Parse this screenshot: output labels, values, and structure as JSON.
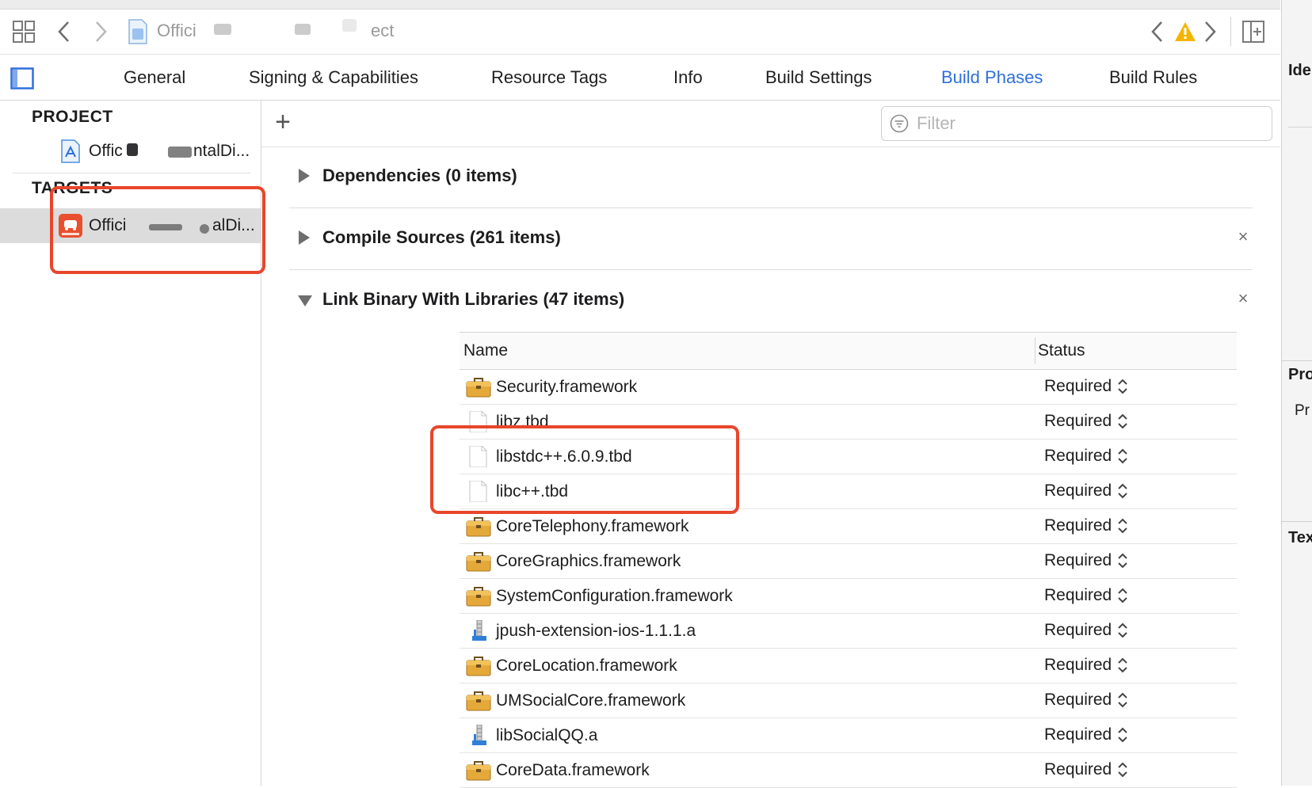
{
  "toolbar": {
    "breadcrumb_project": "Offici",
    "breadcrumb_tail": "ect",
    "icons": [
      "grid-icon",
      "back-icon",
      "forward-icon",
      "project-file-icon",
      "nav-prev-icon",
      "warning-icon",
      "nav-next-icon",
      "add-editor-icon"
    ],
    "warning_color": "#f5b400"
  },
  "tabs": [
    {
      "label": "General"
    },
    {
      "label": "Signing & Capabilities"
    },
    {
      "label": "Resource Tags"
    },
    {
      "label": "Info"
    },
    {
      "label": "Build Settings"
    },
    {
      "label": "Build Phases",
      "active": true
    },
    {
      "label": "Build Rules"
    }
  ],
  "sidebar": {
    "project_header": "PROJECT",
    "project_item": {
      "prefix": "Offic",
      "suffix": "ntalDi..."
    },
    "targets_header": "TARGETS",
    "target_item": {
      "prefix": "Offici",
      "suffix": "alDi..."
    }
  },
  "main": {
    "add_label": "+",
    "filter_placeholder": "Filter",
    "phases": [
      {
        "title": "Dependencies (0 items)",
        "expanded": false,
        "removable": false
      },
      {
        "title": "Compile Sources (261 items)",
        "expanded": false,
        "removable": true
      },
      {
        "title": "Link Binary With Libraries (47 items)",
        "expanded": true,
        "removable": true
      }
    ],
    "close_glyph": "×",
    "table": {
      "col_name": "Name",
      "col_status": "Status",
      "rows": [
        {
          "name": "Security.framework",
          "status": "Required",
          "icon": "framework-toolbox-icon"
        },
        {
          "name": "libz.tbd",
          "status": "Required",
          "icon": "tbd-file-icon"
        },
        {
          "name": "libstdc++.6.0.9.tbd",
          "status": "Required",
          "icon": "tbd-file-icon"
        },
        {
          "name": "libc++.tbd",
          "status": "Required",
          "icon": "tbd-file-icon"
        },
        {
          "name": "CoreTelephony.framework",
          "status": "Required",
          "icon": "framework-toolbox-icon"
        },
        {
          "name": "CoreGraphics.framework",
          "status": "Required",
          "icon": "framework-toolbox-icon"
        },
        {
          "name": "SystemConfiguration.framework",
          "status": "Required",
          "icon": "framework-toolbox-icon"
        },
        {
          "name": "jpush-extension-ios-1.1.1.a",
          "status": "Required",
          "icon": "static-library-icon"
        },
        {
          "name": "CoreLocation.framework",
          "status": "Required",
          "icon": "framework-toolbox-icon"
        },
        {
          "name": "UMSocialCore.framework",
          "status": "Required",
          "icon": "framework-toolbox-icon"
        },
        {
          "name": "libSocialQQ.a",
          "status": "Required",
          "icon": "static-library-icon"
        },
        {
          "name": "CoreData.framework",
          "status": "Required",
          "icon": "framework-toolbox-icon"
        }
      ]
    }
  },
  "inspector": {
    "labels": [
      "Ide",
      "Pro",
      "Pr",
      "Tex"
    ]
  },
  "colors": {
    "accent": "#2f6fdb",
    "highlight": "#e8462b",
    "framework_icon": "#e5a93a"
  }
}
